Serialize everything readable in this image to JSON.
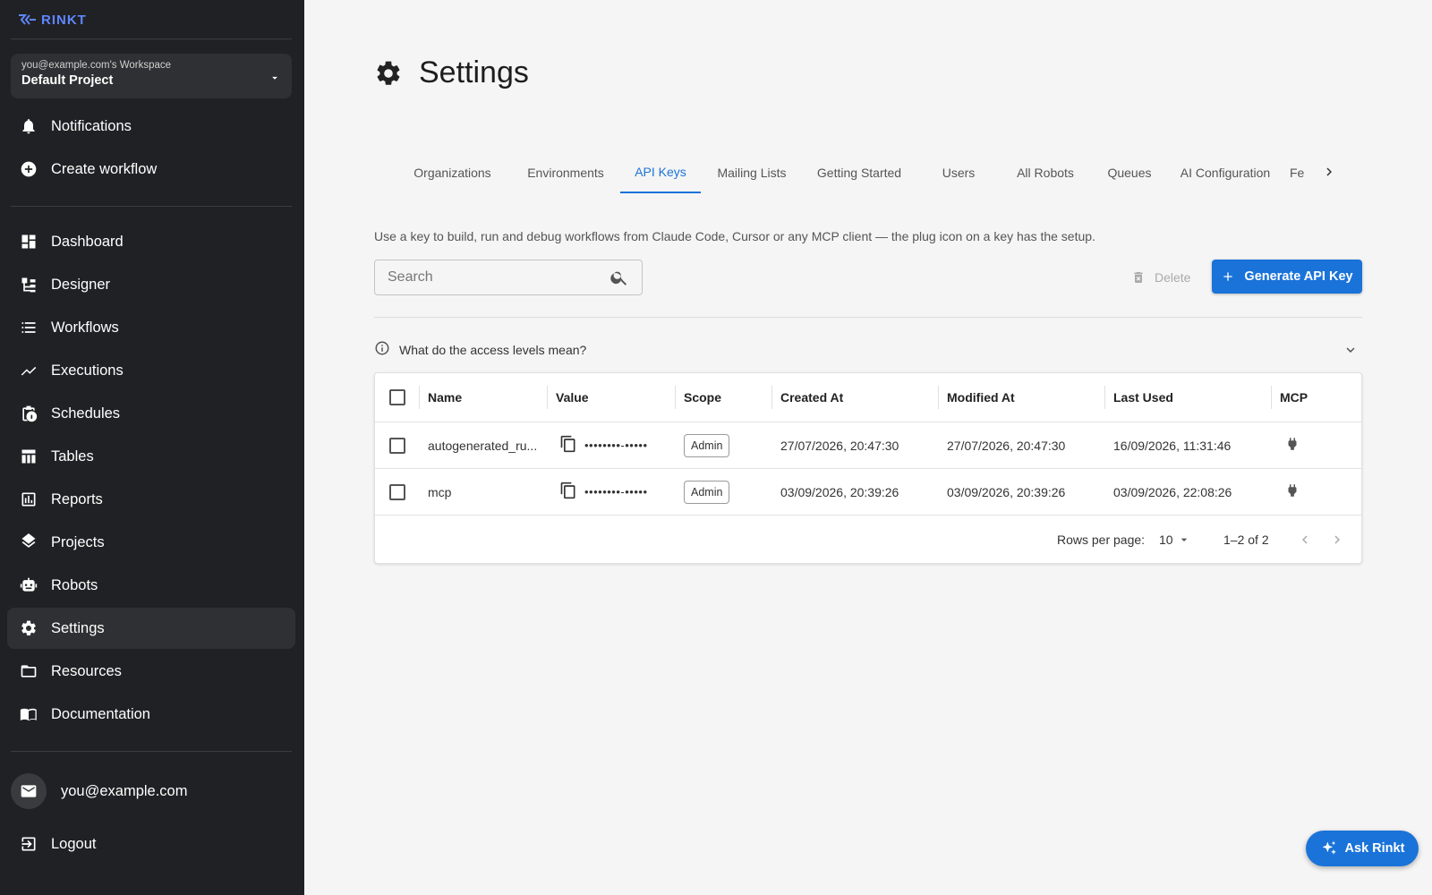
{
  "sidebar": {
    "logo_text": "RINKT",
    "workspace": {
      "label": "you@example.com's Workspace",
      "project": "Default Project"
    },
    "top_items": [
      {
        "label": "Notifications",
        "icon": "bell-icon"
      },
      {
        "label": "Create workflow",
        "icon": "add-circle-icon"
      }
    ],
    "items": [
      {
        "label": "Dashboard",
        "icon": "dashboard-icon"
      },
      {
        "label": "Designer",
        "icon": "designer-icon"
      },
      {
        "label": "Workflows",
        "icon": "list-icon"
      },
      {
        "label": "Executions",
        "icon": "trend-icon"
      },
      {
        "label": "Schedules",
        "icon": "schedule-icon"
      },
      {
        "label": "Tables",
        "icon": "table-icon"
      },
      {
        "label": "Reports",
        "icon": "report-icon"
      },
      {
        "label": "Projects",
        "icon": "layers-icon"
      },
      {
        "label": "Robots",
        "icon": "robot-icon"
      },
      {
        "label": "Settings",
        "icon": "gear-icon",
        "active": true
      },
      {
        "label": "Resources",
        "icon": "folder-icon"
      },
      {
        "label": "Documentation",
        "icon": "book-icon"
      }
    ],
    "user_email": "you@example.com",
    "logout_label": "Logout"
  },
  "main": {
    "title": "Settings",
    "tabs": [
      {
        "label": "Organizations"
      },
      {
        "label": "Environments"
      },
      {
        "label": "API Keys",
        "active": true
      },
      {
        "label": "Mailing Lists"
      },
      {
        "label": "Getting Started"
      },
      {
        "label": "Users"
      },
      {
        "label": "All Robots"
      },
      {
        "label": "Queues"
      },
      {
        "label": "AI Configuration"
      },
      {
        "label": "Fe"
      }
    ],
    "description": "Use a key to build, run and debug workflows from Claude Code, Cursor or any MCP client — the plug icon on a key has the setup.",
    "search": {
      "placeholder": "Search",
      "value": ""
    },
    "delete_label": "Delete",
    "generate_label": "Generate API Key",
    "access_label": "What do the access levels mean?",
    "table": {
      "columns": [
        "Name",
        "Value",
        "Scope",
        "Created At",
        "Modified At",
        "Last Used",
        "MCP"
      ],
      "rows": [
        {
          "name": "autogenerated_ru...",
          "value": "••••••••-•••••",
          "scope": "Admin",
          "created": "27/07/2026, 20:47:30",
          "modified": "27/07/2026, 20:47:30",
          "last_used": "16/09/2026, 11:31:46"
        },
        {
          "name": "mcp",
          "value": "••••••••-•••••",
          "scope": "Admin",
          "created": "03/09/2026, 20:39:26",
          "modified": "03/09/2026, 20:39:26",
          "last_used": "03/09/2026, 22:08:26"
        }
      ],
      "rows_per_page_label": "Rows per page:",
      "rows_per_page": "10",
      "range": "1–2 of 2"
    },
    "ask_label": "Ask Rinkt"
  },
  "colors": {
    "accent": "#1a73d9",
    "sidebar_bg": "#202124",
    "sidebar_active": "#2f3033",
    "page_bg": "#f5f5f5"
  }
}
